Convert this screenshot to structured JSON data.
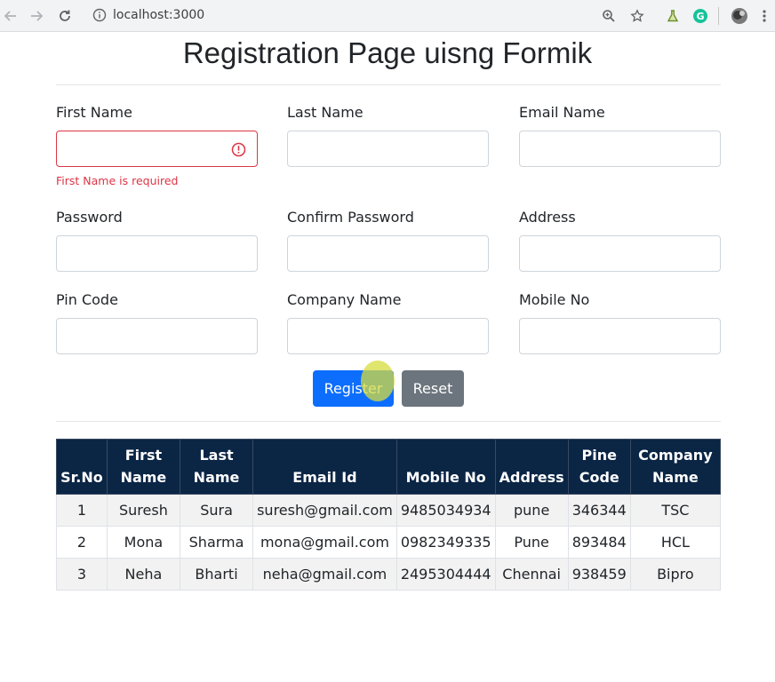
{
  "browser": {
    "url": "localhost:3000"
  },
  "page": {
    "title": "Registration Page uisng Formik"
  },
  "form": {
    "first_name": {
      "label": "First Name",
      "value": "",
      "error": "First Name is required"
    },
    "last_name": {
      "label": "Last Name",
      "value": ""
    },
    "email": {
      "label": "Email Name",
      "value": ""
    },
    "password": {
      "label": "Password",
      "value": ""
    },
    "confirm_password": {
      "label": "Confirm Password",
      "value": ""
    },
    "address": {
      "label": "Address",
      "value": ""
    },
    "pin_code": {
      "label": "Pin Code",
      "value": ""
    },
    "company_name": {
      "label": "Company Name",
      "value": ""
    },
    "mobile_no": {
      "label": "Mobile No",
      "value": ""
    },
    "register_label": "Register",
    "reset_label": "Reset"
  },
  "table": {
    "headers": [
      [
        "Sr.No"
      ],
      [
        "First",
        "Name"
      ],
      [
        "Last",
        "Name"
      ],
      [
        "Email Id"
      ],
      [
        "Mobile No"
      ],
      [
        "Address"
      ],
      [
        "Pine",
        "Code"
      ],
      [
        "Company",
        "Name"
      ]
    ],
    "rows": [
      [
        "1",
        "Suresh",
        "Sura",
        "suresh@gmail.com",
        "9485034934",
        "pune",
        "346344",
        "TSC"
      ],
      [
        "2",
        "Mona",
        "Sharma",
        "mona@gmail.com",
        "0982349335",
        "Pune",
        "893484",
        "HCL"
      ],
      [
        "3",
        "Neha",
        "Bharti",
        "neha@gmail.com",
        "2495304444",
        "Chennai",
        "938459",
        "Bipro"
      ]
    ]
  },
  "colors": {
    "primary": "#0d6efd",
    "secondary": "#6c757d",
    "danger": "#dc3545",
    "table_header": "#0b2545"
  }
}
